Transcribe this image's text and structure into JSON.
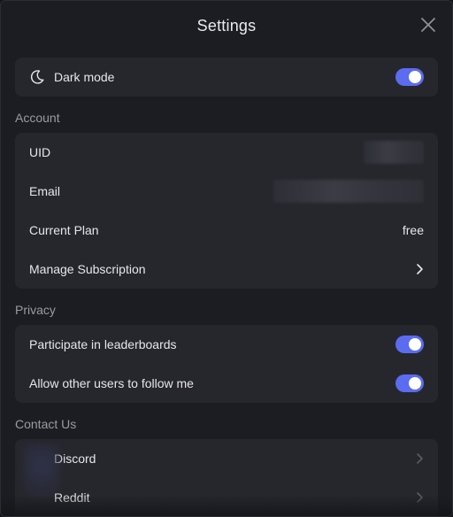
{
  "header": {
    "title": "Settings"
  },
  "appearance": {
    "dark_mode_label": "Dark mode",
    "dark_mode_on": true
  },
  "account": {
    "section_label": "Account",
    "uid_label": "UID",
    "email_label": "Email",
    "plan_label": "Current Plan",
    "plan_value": "free",
    "manage_label": "Manage Subscription"
  },
  "privacy": {
    "section_label": "Privacy",
    "leaderboards_label": "Participate in leaderboards",
    "leaderboards_on": true,
    "follow_label": "Allow other users to follow me",
    "follow_on": true
  },
  "contact": {
    "section_label": "Contact Us",
    "items": [
      {
        "label": "Discord"
      },
      {
        "label": "Reddit"
      }
    ]
  },
  "colors": {
    "background": "#1c1d22",
    "card": "#26272d",
    "toggle_on": "#5b6cf0",
    "section_text": "#9a9ba3"
  },
  "icons": {
    "close": "close-icon",
    "moon": "moon-icon",
    "chevron": "chevron-right-icon"
  }
}
